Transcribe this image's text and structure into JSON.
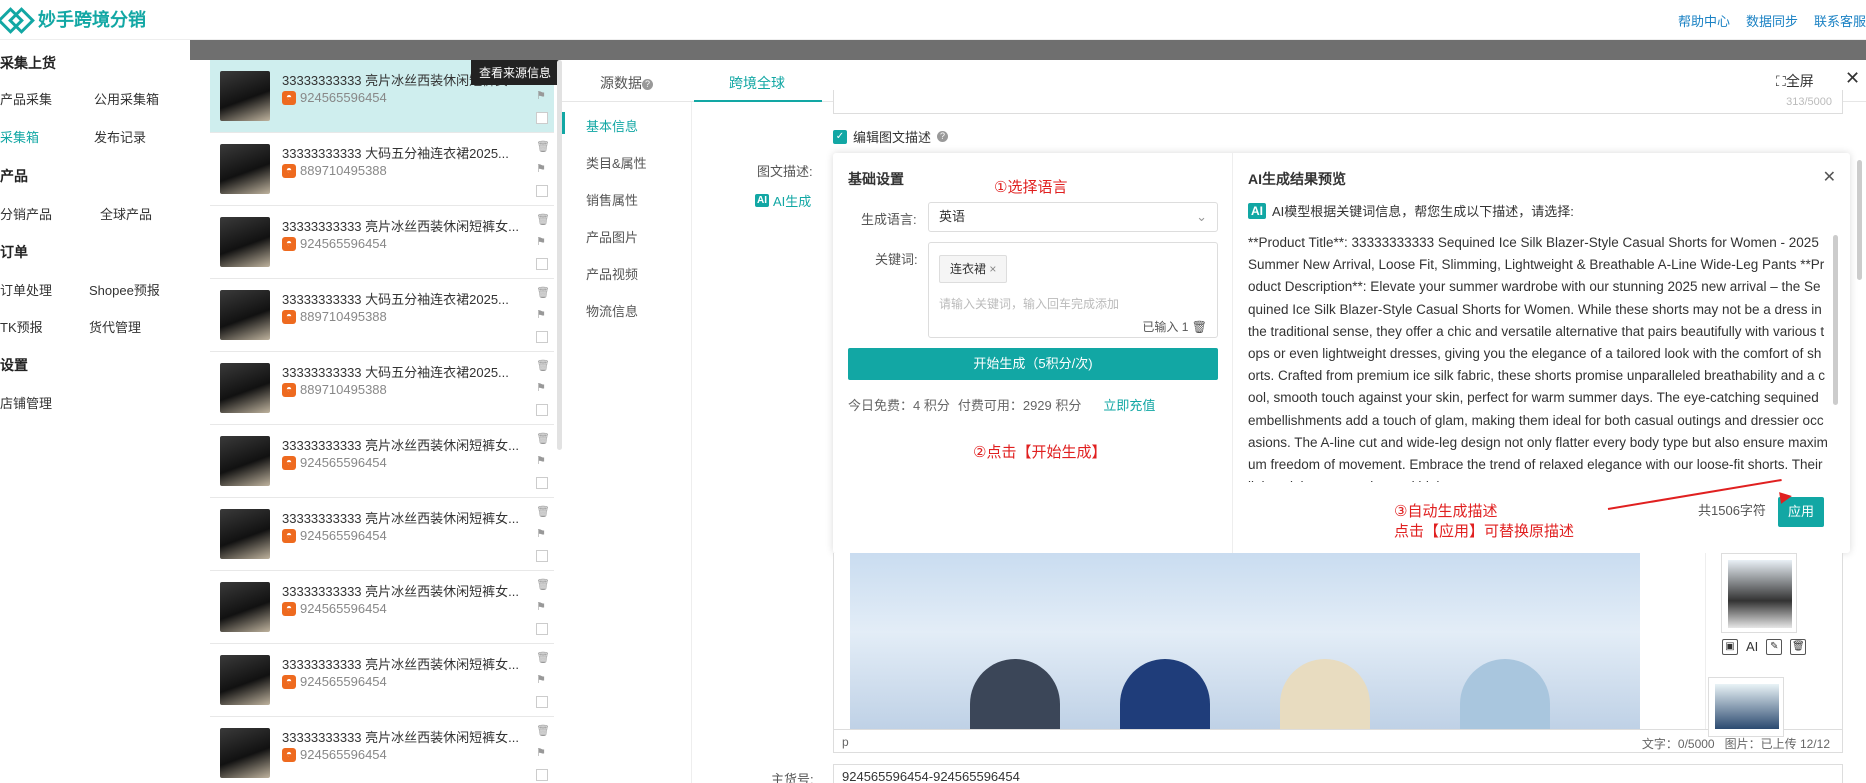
{
  "app": {
    "title": "妙手跨境分销"
  },
  "top_links": [
    "帮助中心",
    "数据同步",
    "联系客服"
  ],
  "sidebar": {
    "sections": [
      {
        "title": "采集上货",
        "items": [
          "产品采集",
          "公用采集箱",
          "采集箱",
          "发布记录"
        ]
      },
      {
        "title": "产品",
        "items": [
          "分销产品",
          "全球产品"
        ]
      },
      {
        "title": "订单",
        "items": [
          "订单处理",
          "Shopee预报",
          "TK预报",
          "货代管理"
        ]
      },
      {
        "title": "设置",
        "items": [
          "店铺管理"
        ]
      }
    ],
    "active": "采集箱"
  },
  "product_list": {
    "tooltip": "查看来源信息",
    "items": [
      {
        "title": "33333333333 亮片冰丝西装休闲短裤女...",
        "shop_id": "924565596454"
      },
      {
        "title": "33333333333 大码五分袖连衣裙2025...",
        "shop_id": "889710495388"
      },
      {
        "title": "33333333333 亮片冰丝西装休闲短裤女...",
        "shop_id": "924565596454"
      },
      {
        "title": "33333333333 大码五分袖连衣裙2025...",
        "shop_id": "889710495388"
      },
      {
        "title": "33333333333 大码五分袖连衣裙2025...",
        "shop_id": "889710495388"
      },
      {
        "title": "33333333333 亮片冰丝西装休闲短裤女...",
        "shop_id": "924565596454"
      },
      {
        "title": "33333333333 亮片冰丝西装休闲短裤女...",
        "shop_id": "924565596454"
      },
      {
        "title": "33333333333 亮片冰丝西装休闲短裤女...",
        "shop_id": "924565596454"
      },
      {
        "title": "33333333333 亮片冰丝西装休闲短裤女...",
        "shop_id": "924565596454"
      },
      {
        "title": "33333333333 亮片冰丝西装休闲短裤女...",
        "shop_id": "924565596454"
      }
    ]
  },
  "tabs": [
    {
      "label": "源数据"
    },
    {
      "label": "跨境全球"
    }
  ],
  "header_actions": {
    "fullscreen": "全屏"
  },
  "subnav": [
    "基本信息",
    "类目&属性",
    "销售属性",
    "产品图片",
    "产品视频",
    "物流信息"
  ],
  "form": {
    "field_count": "313/5000",
    "edit_desc_label": "编辑图文描述",
    "desc_label": "图文描述:",
    "ai_button": "AI生成",
    "sku_label": "主货号:",
    "sku_value": "924565596454-924565596454"
  },
  "ai_panel": {
    "left_title": "基础设置",
    "step1": "①选择语言",
    "lang_label": "生成语言:",
    "lang_value": "英语",
    "kw_label": "关键词:",
    "kw_tag": "连衣裙",
    "kw_placeholder": "请输入关键词，输入回车完成添加",
    "kw_count": "已输入 1",
    "gen_button": "开始生成（5积分/次)",
    "free_credits": "今日免费：4 积分",
    "paid_credits": "付费可用：2929 积分",
    "recharge": "立即充值",
    "step2": "②点击【开始生成】",
    "right_title": "AI生成结果预览",
    "ai_info": "AI模型根据关键词信息，帮您生成以下描述，请选择:",
    "description": "**Product Title**: 33333333333 Sequined Ice Silk Blazer-Style Casual Shorts for Women - 2025 Summer New Arrival, Loose Fit, Slimming, Lightweight & Breathable A-Line Wide-Leg Pants **Product Description**: Elevate your summer wardrobe with our stunning 2025 new arrival – the Sequined Ice Silk Blazer-Style Casual Shorts for Women. While these shorts may not be a dress in the traditional sense, they offer a chic and versatile alternative that pairs beautifully with various tops or even lightweight dresses, giving you the elegance of a tailored look with the comfort of shorts. Crafted from premium ice silk fabric, these shorts promise unparalleled breathability and a cool, smooth touch against your skin, perfect for warm summer days. The eye-catching sequined embellishments add a touch of glam, making them ideal for both casual outings and dressier occasions. The A-line cut and wide-leg design not only flatter every body type but also ensure maximum freedom of movement. Embrace the trend of relaxed elegance with our loose-fit shorts. Their lightweight construction and high-",
    "char_total": "共1506字符",
    "apply": "应用",
    "step3_line1": "③自动生成描述",
    "step3_line2": "点击【应用】可替换原描述"
  },
  "editor": {
    "path": "p",
    "text_count": "文字：0/5000",
    "image_count": "图片：已上传 12/12",
    "thumb_tools": [
      "AI"
    ]
  }
}
